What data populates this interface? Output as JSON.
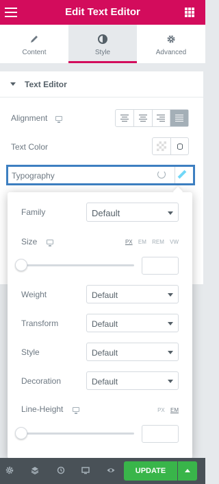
{
  "header": {
    "title": "Edit Text Editor",
    "menu_icon": "hamburger-icon",
    "apps_icon": "grid-icon"
  },
  "tabs": [
    {
      "label": "Content",
      "icon": "pencil-icon"
    },
    {
      "label": "Style",
      "icon": "contrast-icon",
      "active": true
    },
    {
      "label": "Advanced",
      "icon": "gear-icon"
    }
  ],
  "section": {
    "title": "Text Editor"
  },
  "controls": {
    "alignment_label": "Alignment",
    "text_color_label": "Text Color",
    "typography_label": "Typography"
  },
  "typography": {
    "family_label": "Family",
    "family_value": "Default",
    "size_label": "Size",
    "size_units": [
      "PX",
      "EM",
      "REM",
      "VW"
    ],
    "weight_label": "Weight",
    "weight_value": "Default",
    "transform_label": "Transform",
    "transform_value": "Default",
    "style_label": "Style",
    "style_value": "Default",
    "decoration_label": "Decoration",
    "decoration_value": "Default",
    "line_height_label": "Line-Height",
    "line_height_units": [
      "PX",
      "EM"
    ]
  },
  "footer": {
    "update_label": "UPDATE"
  },
  "colors": {
    "brand": "#d30c5c",
    "accent_blue": "#3d7fc1",
    "update_green": "#39b54a",
    "footer_bg": "#495157"
  }
}
